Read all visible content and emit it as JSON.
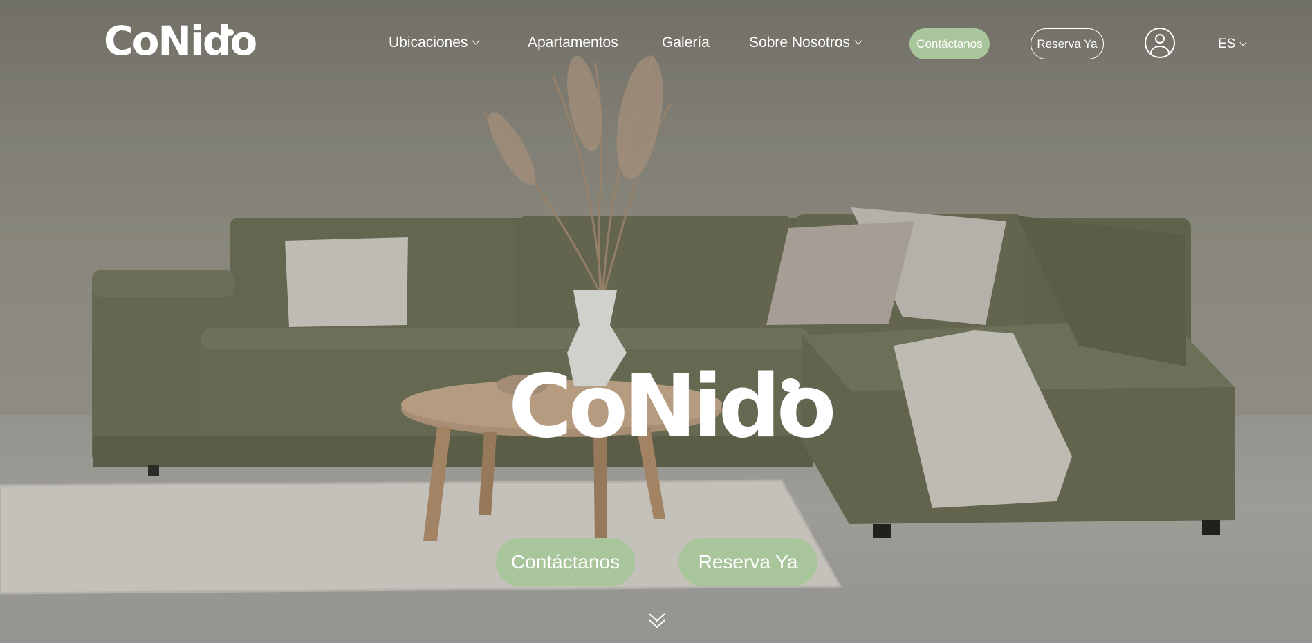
{
  "brand": {
    "logo_text": "CoNido",
    "accent_color": "#a9c59b"
  },
  "nav": {
    "items": [
      {
        "label": "Ubicaciones",
        "has_dropdown": true
      },
      {
        "label": "Apartamentos",
        "has_dropdown": false
      },
      {
        "label": "Galería",
        "has_dropdown": false
      },
      {
        "label": "Sobre Nosotros",
        "has_dropdown": true
      }
    ],
    "contact_label": "Contáctanos",
    "book_label": "Reserva Ya",
    "account_icon": "user-icon",
    "language": "ES"
  },
  "hero": {
    "logo_text": "CoNido",
    "contact_label": "Contáctanos",
    "book_label": "Reserva Ya",
    "scroll_icon": "double-chevron-down-icon"
  }
}
